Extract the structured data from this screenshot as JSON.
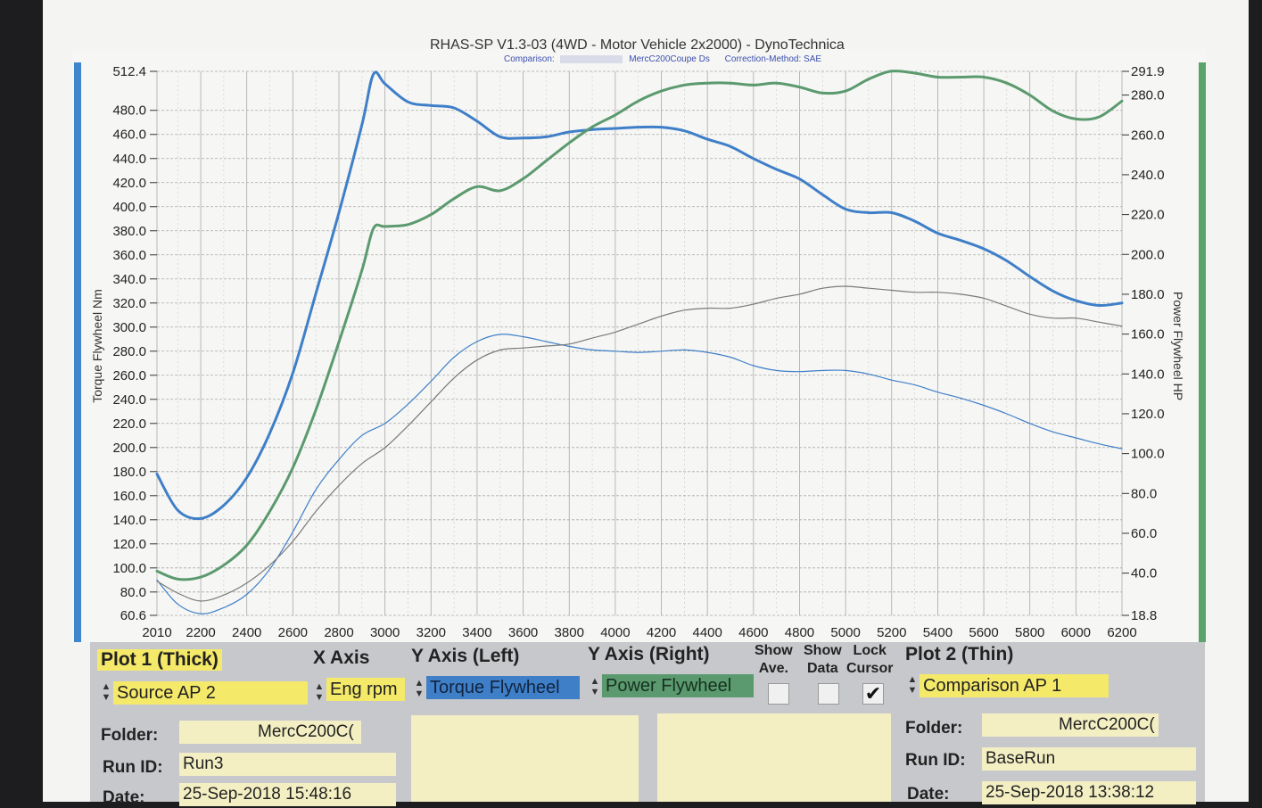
{
  "header": {
    "title": "RHAS-SP V1.3-03  (4WD - Motor Vehicle 2x2000) - DynoTechnica",
    "comparison_label": "Comparison:",
    "comparison_value": "MercC200Coupe Ds",
    "correction": "Correction-Method: SAE"
  },
  "colors": {
    "torque": "#3f7fc8",
    "power": "#5b9a6e",
    "thin_power": "#7a7a7a",
    "panel": "#c7c8cc",
    "field": "#f3efc3",
    "plot1_label_bg": "#f5e96a"
  },
  "chart_data": {
    "type": "line",
    "xlabel": "",
    "ylabel_left": "Torque Flywheel Nm",
    "ylabel_right": "Power Flywheel HP",
    "xlim": [
      2010,
      6200
    ],
    "ylim_left": [
      60.6,
      512.4
    ],
    "ylim_right": [
      18.8,
      291.9
    ],
    "grid": true,
    "x_ticks": [
      "2010",
      "2200",
      "2400",
      "2600",
      "2800",
      "3000",
      "3200",
      "3400",
      "3600",
      "3800",
      "4000",
      "4200",
      "4400",
      "4600",
      "4800",
      "5000",
      "5200",
      "5400",
      "5600",
      "5800",
      "6000",
      "6200"
    ],
    "y_left_ticks": [
      "512.4",
      "480.0",
      "460.0",
      "440.0",
      "420.0",
      "400.0",
      "380.0",
      "360.0",
      "340.0",
      "320.0",
      "300.0",
      "280.0",
      "260.0",
      "240.0",
      "220.0",
      "200.0",
      "180.0",
      "160.0",
      "140.0",
      "120.0",
      "100.0",
      "80.0",
      "60.6"
    ],
    "y_right_ticks": [
      "291.9",
      "280.0",
      "260.0",
      "240.0",
      "220.0",
      "200.0",
      "180.0",
      "160.0",
      "140.0",
      "120.0",
      "100.0",
      "80.0",
      "60.0",
      "40.0",
      "18.8"
    ],
    "series": [
      {
        "name": "Torque Flywheel",
        "plot": "Plot 1 (Thick)",
        "axis": "left",
        "color": "#3f7fc8",
        "x": [
          2010,
          2100,
          2200,
          2300,
          2400,
          2500,
          2600,
          2700,
          2800,
          2900,
          2950,
          3000,
          3100,
          3200,
          3300,
          3400,
          3500,
          3600,
          3700,
          3800,
          3900,
          4000,
          4100,
          4200,
          4300,
          4400,
          4500,
          4600,
          4700,
          4800,
          4900,
          5000,
          5100,
          5200,
          5300,
          5400,
          5500,
          5600,
          5700,
          5800,
          5900,
          6000,
          6100,
          6200
        ],
        "y": [
          178,
          148,
          141,
          152,
          175,
          212,
          262,
          328,
          395,
          468,
          510,
          502,
          487,
          484,
          482,
          471,
          458,
          457,
          458,
          462,
          464,
          465,
          466,
          466,
          463,
          456,
          450,
          440,
          431,
          423,
          410,
          398,
          395,
          395,
          388,
          378,
          372,
          365,
          355,
          342,
          330,
          322,
          318,
          320
        ]
      },
      {
        "name": "Power Flywheel",
        "plot": "Plot 1 (Thick)",
        "axis": "right",
        "color": "#5b9a6e",
        "x": [
          2010,
          2100,
          2200,
          2300,
          2400,
          2500,
          2600,
          2700,
          2800,
          2900,
          2950,
          3000,
          3100,
          3200,
          3300,
          3400,
          3500,
          3600,
          3700,
          3800,
          3900,
          4000,
          4100,
          4200,
          4300,
          4400,
          4500,
          4600,
          4700,
          4800,
          4900,
          5000,
          5100,
          5200,
          5300,
          5400,
          5500,
          5600,
          5700,
          5800,
          5900,
          6000,
          6100,
          6200
        ],
        "y": [
          41,
          37,
          38,
          44,
          54,
          71,
          93,
          122,
          156,
          192,
          213,
          214,
          215,
          220,
          228,
          234,
          232,
          238,
          247,
          256,
          264,
          270,
          277,
          282,
          285,
          286,
          286,
          285,
          286,
          284,
          281,
          282,
          288,
          292,
          291,
          289,
          289,
          289,
          286,
          280,
          272,
          268,
          269,
          277
        ]
      },
      {
        "name": "Comparison Torque",
        "plot": "Plot 2 (Thin)",
        "axis": "left",
        "color": "#3f7fc8",
        "x": [
          2010,
          2100,
          2200,
          2300,
          2400,
          2500,
          2600,
          2700,
          2800,
          2900,
          3000,
          3100,
          3200,
          3300,
          3400,
          3500,
          3600,
          3700,
          3800,
          3900,
          4000,
          4100,
          4200,
          4300,
          4400,
          4500,
          4600,
          4700,
          4800,
          4900,
          5000,
          5100,
          5200,
          5300,
          5400,
          5500,
          5600,
          5700,
          5800,
          5900,
          6000,
          6100,
          6200
        ],
        "y": [
          90,
          70,
          62,
          67,
          78,
          99,
          130,
          165,
          190,
          210,
          220,
          236,
          255,
          275,
          288,
          294,
          292,
          288,
          284,
          281,
          280,
          279,
          280,
          281,
          279,
          275,
          268,
          264,
          263,
          264,
          264,
          261,
          256,
          252,
          246,
          241,
          235,
          228,
          220,
          213,
          208,
          203,
          199
        ]
      },
      {
        "name": "Comparison Power",
        "plot": "Plot 2 (Thin)",
        "axis": "right",
        "color": "#7a7a7a",
        "x": [
          2010,
          2100,
          2200,
          2300,
          2400,
          2500,
          2600,
          2700,
          2800,
          2900,
          3000,
          3100,
          3200,
          3300,
          3400,
          3500,
          3600,
          3700,
          3800,
          3900,
          4000,
          4100,
          4200,
          4300,
          4400,
          4500,
          4600,
          4700,
          4800,
          4900,
          5000,
          5100,
          5200,
          5300,
          5400,
          5500,
          5600,
          5700,
          5800,
          5900,
          6000,
          6100,
          6200
        ],
        "y": [
          36,
          30,
          26,
          29,
          35,
          44,
          56,
          71,
          84,
          95,
          103,
          114,
          126,
          138,
          147,
          152,
          153,
          154,
          155,
          158,
          161,
          165,
          169,
          172,
          173,
          173,
          175,
          178,
          180,
          183,
          184,
          183,
          182,
          181,
          181,
          180,
          178,
          174,
          170,
          168,
          168,
          166,
          164
        ]
      }
    ]
  },
  "controls": {
    "plot1": {
      "label": "Plot 1 (Thick)",
      "source": "Source AP 2"
    },
    "x_axis": {
      "label": "X Axis",
      "value": "Eng rpm"
    },
    "y_left": {
      "label": "Y Axis (Left)",
      "value": "Torque Flywheel"
    },
    "y_right": {
      "label": "Y Axis (Right)",
      "value": "Power Flywheel"
    },
    "show_ave": {
      "label1": "Show",
      "label2": "Ave.",
      "checked": false
    },
    "show_data": {
      "label1": "Show",
      "label2": "Data",
      "checked": false
    },
    "lock_cursor": {
      "label1": "Lock",
      "label2": "Cursor",
      "checked": true
    },
    "plot2": {
      "label": "Plot 2 (Thin)",
      "source": "Comparison AP 1"
    },
    "left": {
      "folder_label": "Folder:",
      "folder": "MercC200C(",
      "runid_label": "Run ID:",
      "runid": "Run3",
      "date_label": "Date:",
      "date": "25-Sep-2018  15:48:16"
    },
    "right": {
      "folder_label": "Folder:",
      "folder": "MercC200C(",
      "runid_label": "Run ID:",
      "runid": "BaseRun",
      "date_label": "Date:",
      "date": "25-Sep-2018  13:38:12"
    }
  }
}
